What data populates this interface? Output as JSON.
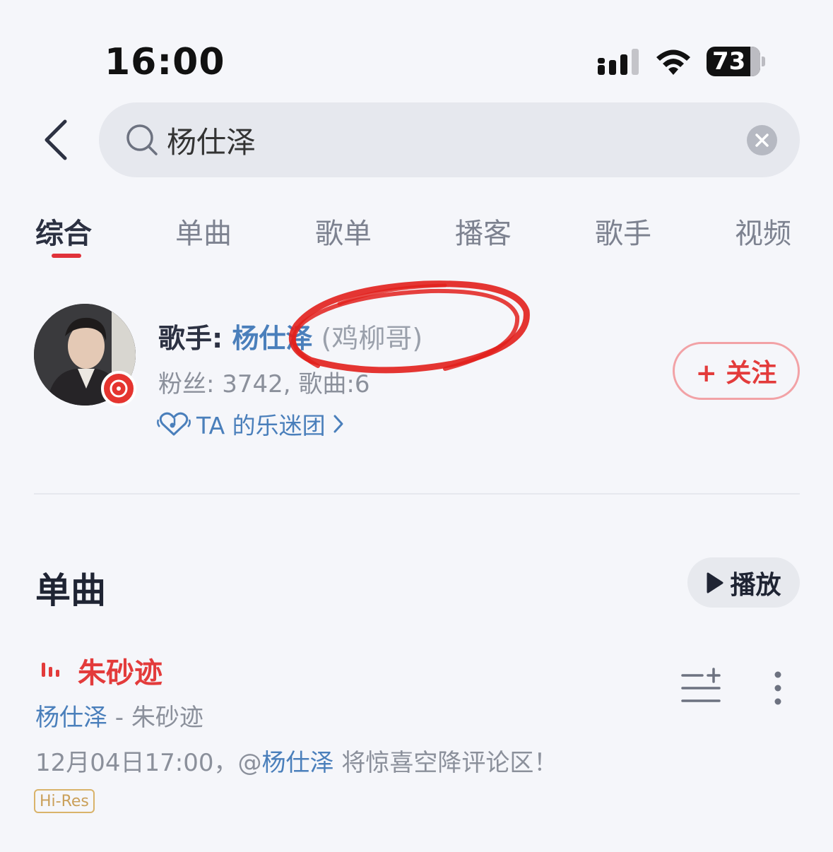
{
  "status_bar": {
    "time": "16:00",
    "battery": "73",
    "battery_level": 0.73
  },
  "search": {
    "query": "杨仕泽",
    "placeholder": ""
  },
  "tabs": [
    {
      "label": "综合",
      "active": true
    },
    {
      "label": "单曲",
      "active": false
    },
    {
      "label": "歌单",
      "active": false
    },
    {
      "label": "播客",
      "active": false
    },
    {
      "label": "歌手",
      "active": false
    },
    {
      "label": "视频",
      "active": false
    }
  ],
  "singer": {
    "label": "歌手: ",
    "name": "杨仕泽",
    "alias": " (鸡柳哥)",
    "fans_text": "粉丝: 3742, 歌曲:6",
    "fanclub": "TA 的乐迷团",
    "follow": "+ 关注"
  },
  "songs_section": {
    "title": "单曲",
    "play_label": "播放",
    "items": [
      {
        "title": "朱砂迹",
        "artist": "杨仕泽",
        "artist_sep": " - ",
        "album": "朱砂迹",
        "desc_prefix": "12月04日17:00，@",
        "desc_mention": "杨仕泽",
        "desc_suffix": " 将惊喜空降评论区！",
        "quality": "Hi-Res"
      }
    ]
  },
  "colors": {
    "accent_red": "#e33b3b",
    "link_blue": "#4a7fbb",
    "annotation_red": "#e2201c"
  },
  "icons": [
    "back-icon",
    "search-icon",
    "clear-icon",
    "signal-icon",
    "wifi-icon",
    "battery-icon",
    "fanclub-heart-icon",
    "chevron-right-icon",
    "play-icon",
    "playing-bars-icon",
    "add-to-playlist-icon",
    "more-icon"
  ]
}
